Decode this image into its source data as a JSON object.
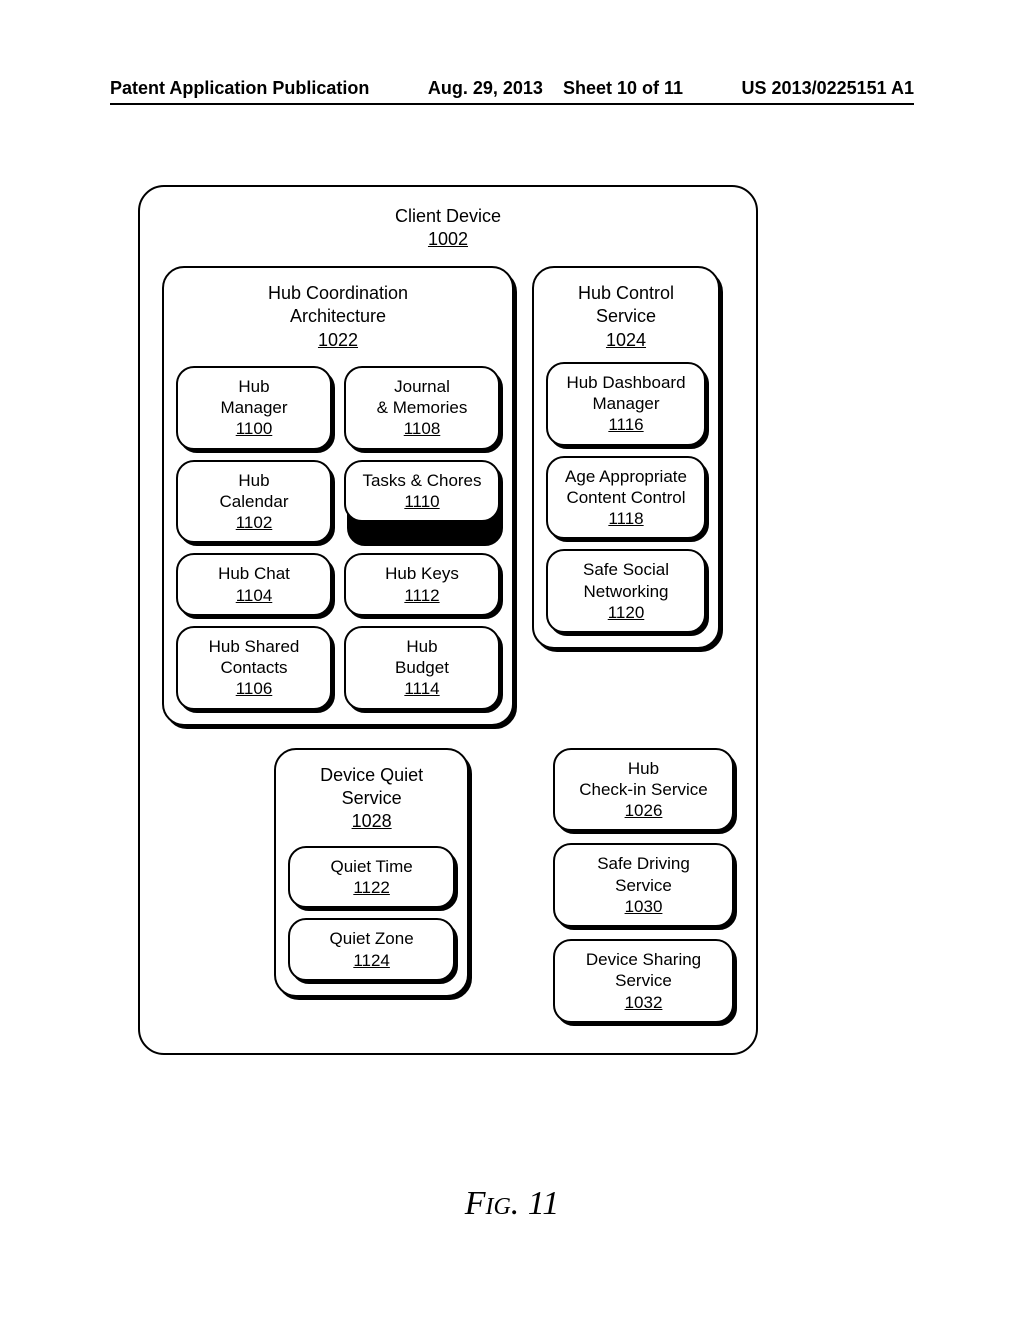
{
  "header": {
    "left": "Patent Application Publication",
    "date": "Aug. 29, 2013",
    "sheet": "Sheet 10 of 11",
    "pubno": "US 2013/0225151 A1"
  },
  "client_device": {
    "label": "Client Device",
    "ref": "1002"
  },
  "hub_coord": {
    "label1": "Hub Coordination",
    "label2": "Architecture",
    "ref": "1022",
    "items": [
      {
        "label1": "Hub",
        "label2": "Manager",
        "ref": "1100"
      },
      {
        "label1": "Journal",
        "label2": "& Memories",
        "ref": "1108"
      },
      {
        "label1": "Hub",
        "label2": "Calendar",
        "ref": "1102"
      },
      {
        "label1": "Tasks & Chores",
        "label2": "",
        "ref": "1110"
      },
      {
        "label1": "Hub Chat",
        "label2": "",
        "ref": "1104"
      },
      {
        "label1": "Hub Keys",
        "label2": "",
        "ref": "1112"
      },
      {
        "label1": "Hub Shared",
        "label2": "Contacts",
        "ref": "1106"
      },
      {
        "label1": "Hub",
        "label2": "Budget",
        "ref": "1114"
      }
    ]
  },
  "hub_control": {
    "label": "Hub Control Service",
    "ref": "1024",
    "items": [
      {
        "label1": "Hub Dashboard",
        "label2": "Manager",
        "ref": "1116"
      },
      {
        "label1": "Age Appropriate",
        "label2": "Content Control",
        "ref": "1118"
      },
      {
        "label1": "Safe Social",
        "label2": "Networking",
        "ref": "1120"
      }
    ]
  },
  "quiet": {
    "label1": "Device Quiet",
    "label2": "Service",
    "ref": "1028",
    "items": [
      {
        "label1": "Quiet Time",
        "ref": "1122"
      },
      {
        "label1": "Quiet Zone",
        "ref": "1124"
      }
    ]
  },
  "right_services": [
    {
      "label1": "Hub",
      "label2": "Check-in Service",
      "ref": "1026"
    },
    {
      "label1": "Safe Driving",
      "label2": "Service",
      "ref": "1030"
    },
    {
      "label1": "Device Sharing",
      "label2": "Service",
      "ref": "1032"
    }
  ],
  "figcaption": "Fig. 11"
}
